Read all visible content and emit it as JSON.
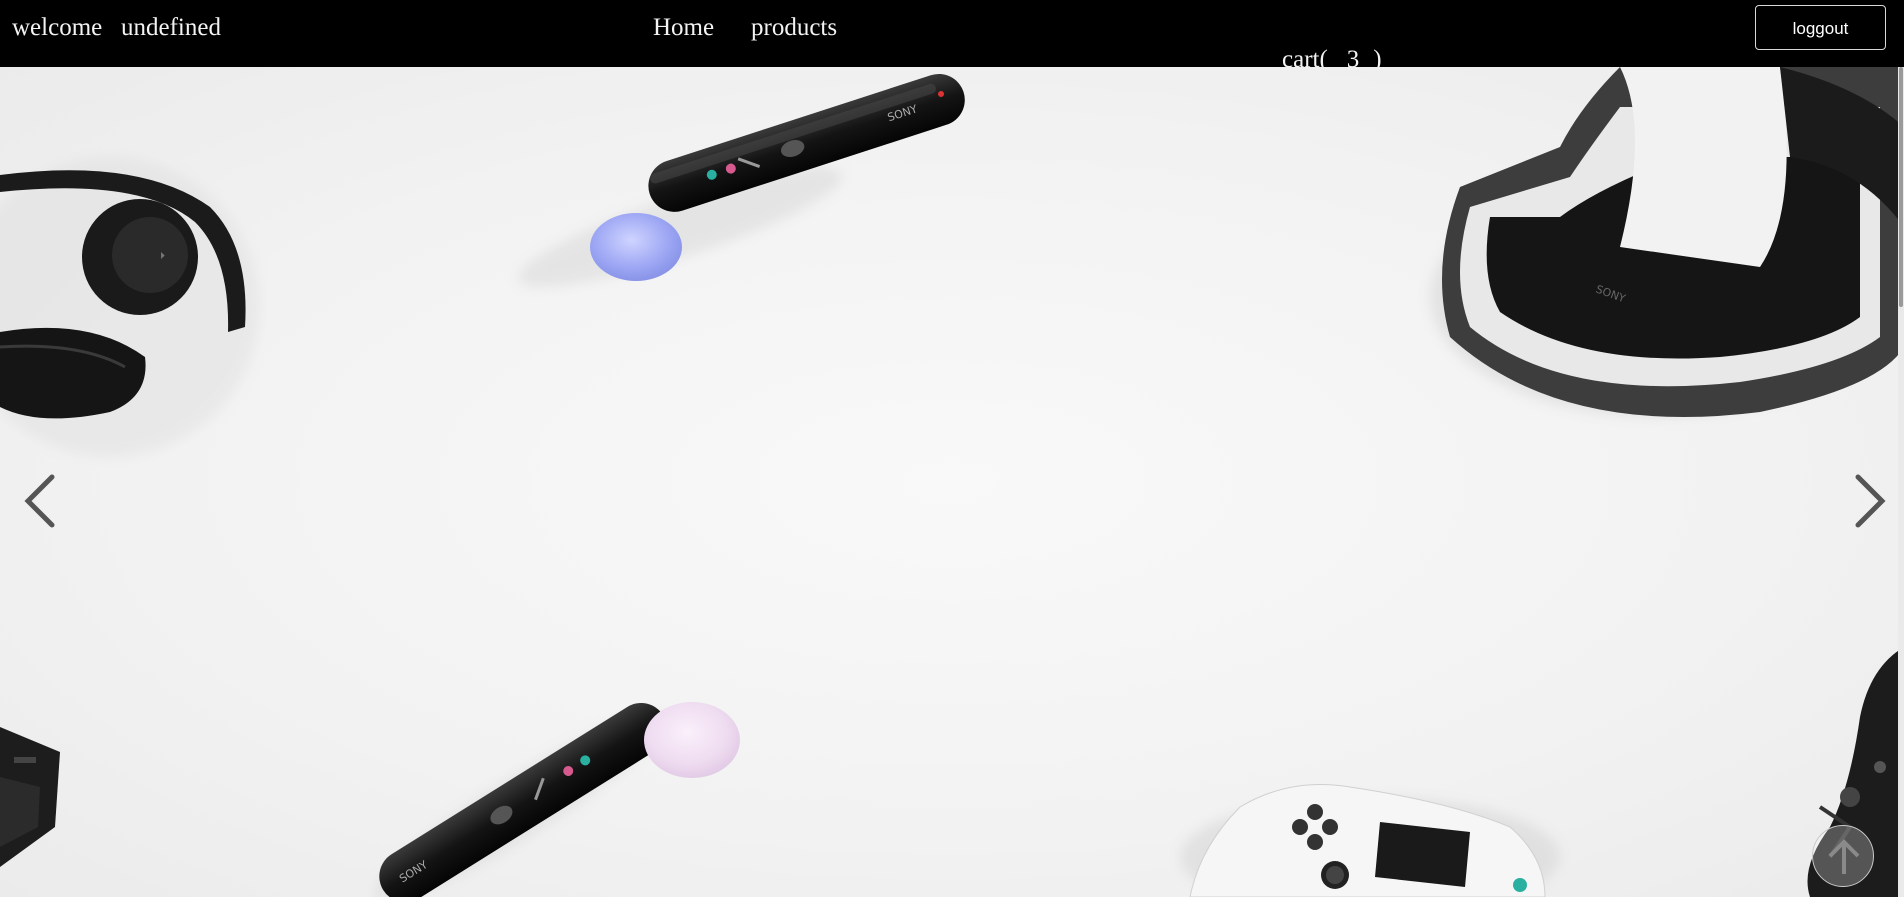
{
  "navbar": {
    "welcome_label": "welcome",
    "username": "undefined",
    "home_link": "Home",
    "products_link": "products",
    "cart_label": "cart(",
    "cart_count": "3",
    "cart_close": ")",
    "logout_label": "loggout"
  },
  "carousel": {
    "prev_icon": "chevron-left-icon",
    "next_icon": "chevron-right-icon",
    "scroll_top_icon": "arrow-up-icon"
  },
  "colors": {
    "navbar_bg": "#000000",
    "nav_text": "#f3f3f3",
    "hero_bg": "#f2f2f2",
    "arrow": "#555555"
  }
}
